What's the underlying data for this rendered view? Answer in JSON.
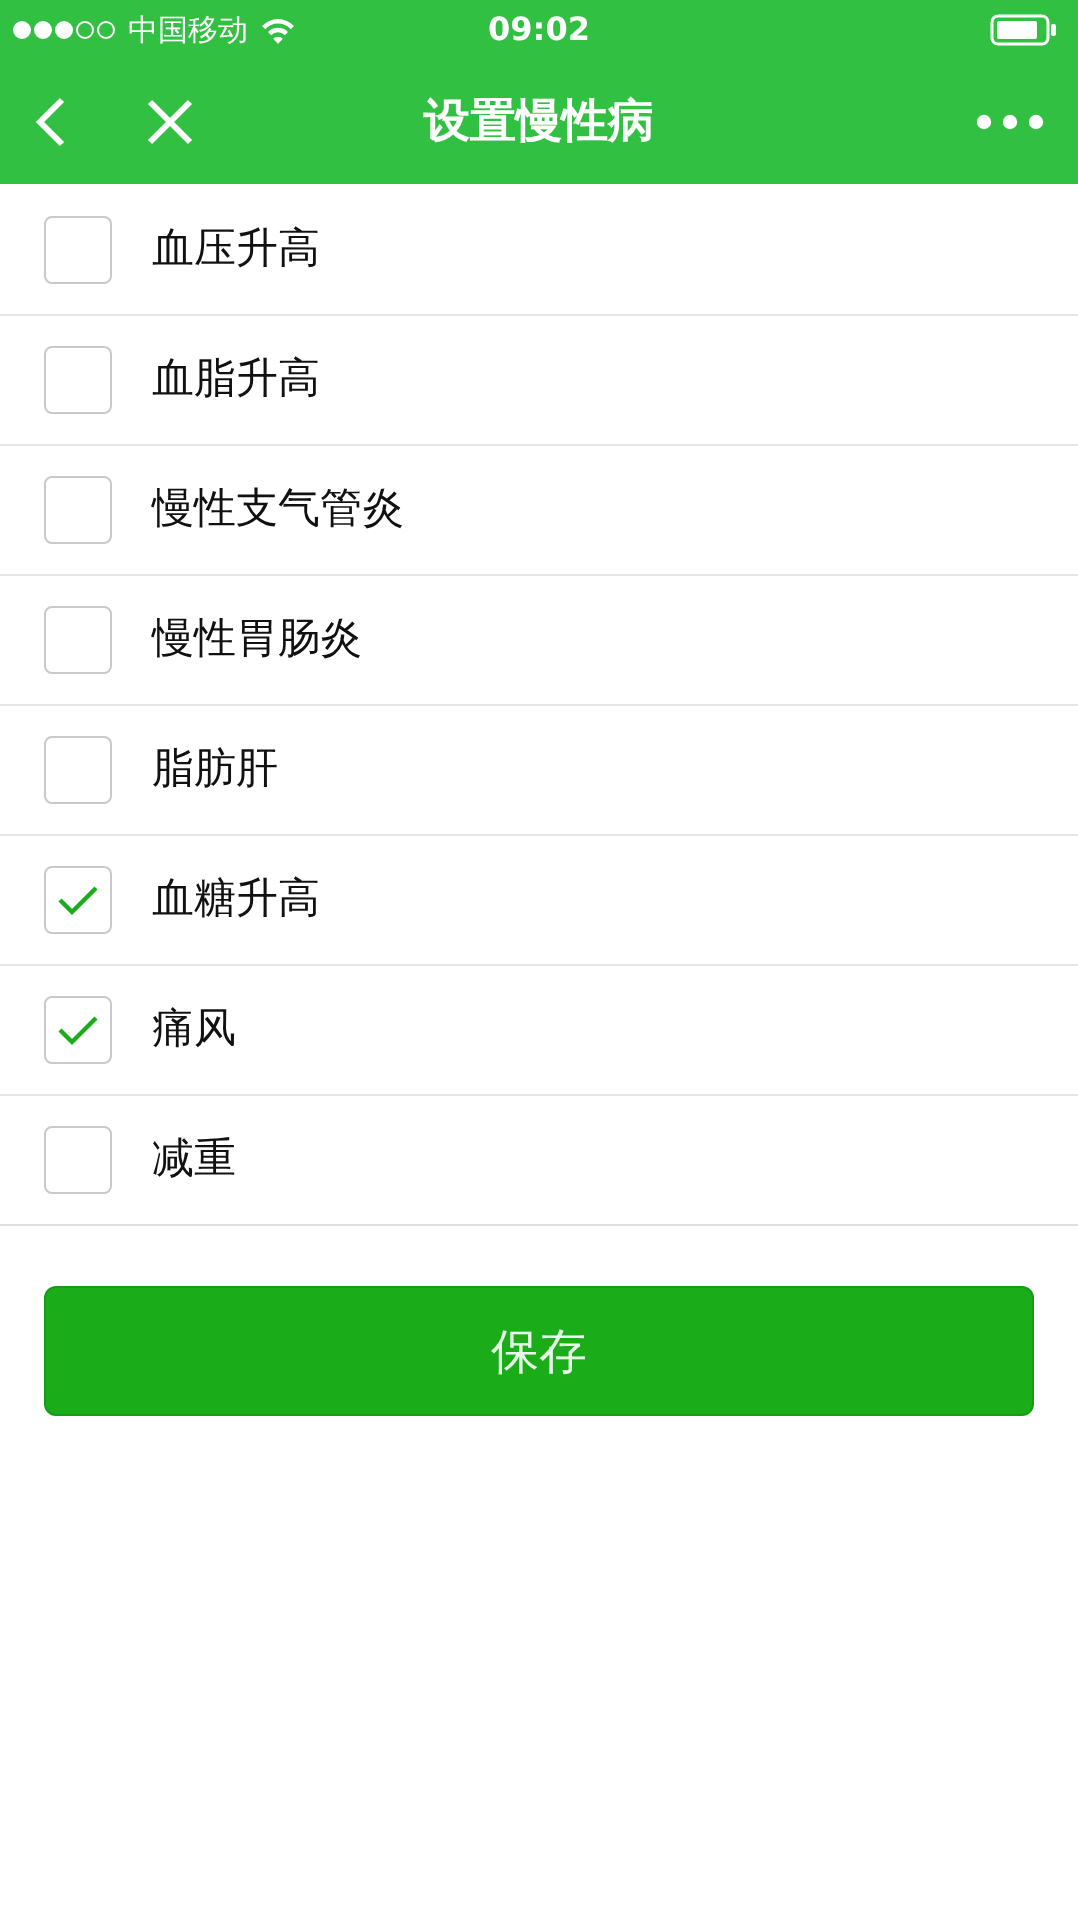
{
  "status_bar": {
    "carrier": "中国移动",
    "time": "09:02"
  },
  "nav": {
    "title": "设置慢性病"
  },
  "items": [
    {
      "label": "血压升高",
      "checked": false
    },
    {
      "label": "血脂升高",
      "checked": false
    },
    {
      "label": "慢性支气管炎",
      "checked": false
    },
    {
      "label": "慢性胃肠炎",
      "checked": false
    },
    {
      "label": "脂肪肝",
      "checked": false
    },
    {
      "label": "血糖升高",
      "checked": true
    },
    {
      "label": "痛风",
      "checked": true
    },
    {
      "label": "减重",
      "checked": false
    }
  ],
  "save_button": "保存"
}
